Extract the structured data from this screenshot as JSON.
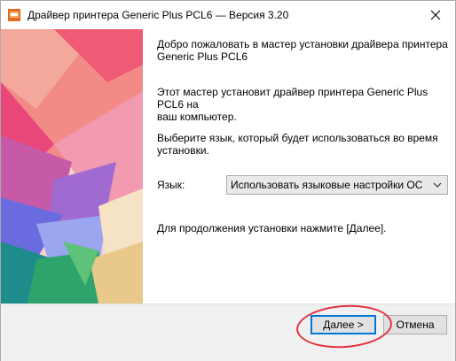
{
  "window": {
    "title": "Драйвер принтера Generic Plus PCL6 — Версия 3.20"
  },
  "icons": {
    "app": "printer-installer-icon",
    "close": "close-icon",
    "dropdown": "chevron-down-icon"
  },
  "main": {
    "welcome_line1": "Добро пожаловать в мастер установки драйвера принтера",
    "welcome_line2": "Generic Plus PCL6",
    "install_line1": "Этот мастер установит драйвер принтера Generic Plus PCL6 на",
    "install_line2": "ваш компьютер.",
    "select_lang_line1": "Выберите язык, который будет использоваться во время",
    "select_lang_line2": "установки.",
    "language_label": "Язык:",
    "language_value": "Использовать языковые настройки ОС",
    "continue_text": "Для продолжения установки нажмите [Далее]."
  },
  "footer": {
    "next_label": "Далее >",
    "cancel_label": "Отмена"
  },
  "colors": {
    "accent": "#0078d7",
    "highlight": "#e0323c",
    "footer_bg": "#f0f0f0"
  }
}
